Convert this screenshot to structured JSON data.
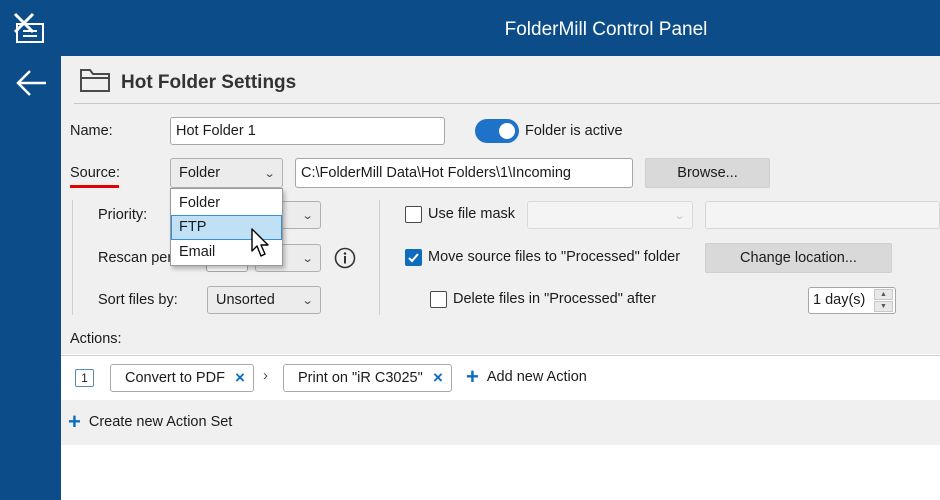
{
  "window": {
    "title": "FolderMill Control Panel"
  },
  "header": {
    "title": "Hot Folder Settings"
  },
  "form": {
    "name_label": "Name:",
    "name_value": "Hot Folder 1",
    "active_toggle_label": "Folder is active",
    "active_toggle_on": true,
    "source_label": "Source:",
    "source_value": "Folder",
    "source_path": "C:\\FolderMill Data\\Hot Folders\\1\\Incoming",
    "browse_label": "Browse...",
    "priority_label": "Priority:",
    "rescan_label": "Rescan per",
    "sort_label": "Sort files by:",
    "sort_value": "Unsorted",
    "use_file_mask_label": "Use file mask",
    "use_file_mask_checked": false,
    "move_processed_label": "Move source files to \"Processed\" folder",
    "move_processed_checked": true,
    "change_location_label": "Change location...",
    "delete_processed_label": "Delete files in \"Processed\" after",
    "delete_processed_checked": false,
    "delete_after_value": "1 day(s)"
  },
  "source_dropdown": {
    "options": [
      "Folder",
      "FTP",
      "Email"
    ],
    "highlighted": "FTP"
  },
  "actions": {
    "label": "Actions:",
    "set_number": "1",
    "chips": [
      {
        "label": "Convert to PDF"
      },
      {
        "label": "Print on \"iR C3025\""
      }
    ],
    "add_action_label": "Add new Action",
    "create_action_set_label": "Create new Action Set"
  },
  "icons": {
    "logo": "foldermill-logo-icon",
    "back": "back-arrow-icon",
    "folder": "folder-icon",
    "info": "info-icon",
    "chain": "chevron-right-icon",
    "remove": "close-icon",
    "add": "plus-icon"
  },
  "colors": {
    "titlebar": "#0c4c88",
    "accent": "#0f6cbd",
    "source_underline": "#e30000",
    "selection": "#bfe0f5"
  }
}
